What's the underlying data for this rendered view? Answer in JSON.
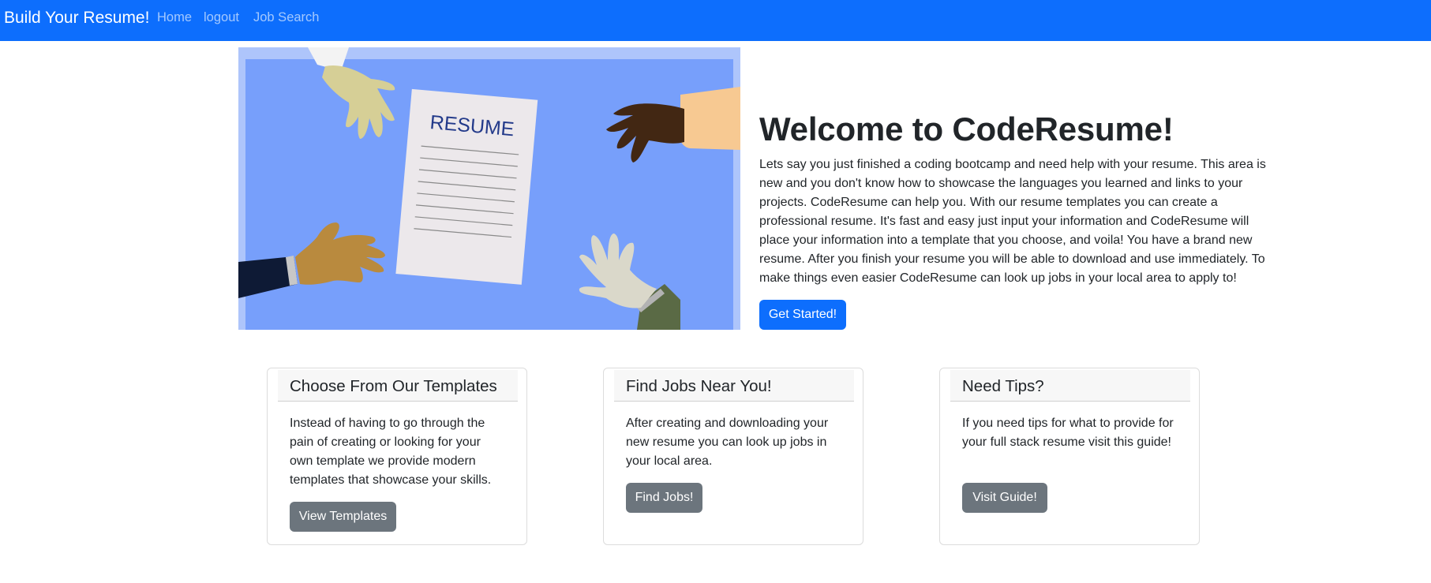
{
  "navbar": {
    "brand": "Build Your Resume!",
    "links": [
      "Home",
      "logout",
      "Job Search"
    ]
  },
  "hero": {
    "image_text": "RESUME",
    "title": "Welcome to CodeResume!",
    "description": "Lets say you just finished a coding bootcamp and need help with your resume. This area is new and you don't know how to showcase the languages you learned and links to your projects. CodeResume can help you. With our resume templates you can create a professional resume. It's fast and easy just input your information and CodeResume will place your information into a template that you choose, and voila! You have a brand new resume. After you finish your resume you will be able to download and use immediately. To make things even easier CodeResume can look up jobs in your local area to apply to!",
    "button": "Get Started!"
  },
  "cards": [
    {
      "title": "Choose From Our Templates",
      "text": "Instead of having to go through the pain of creating or looking for your own template we provide modern templates that showcase your skills.",
      "button": "View Templates"
    },
    {
      "title": "Find Jobs Near You!",
      "text": "After creating and downloading your new resume you can look up jobs in your local area.",
      "button": "Find Jobs!"
    },
    {
      "title": "Need Tips?",
      "text": "If you need tips for what to provide for your full stack resume visit this guide!",
      "button": "Visit Guide!"
    }
  ],
  "colors": {
    "primary": "#0d6efd",
    "secondary": "#6c757d",
    "hero_bg": "#779ffb"
  }
}
